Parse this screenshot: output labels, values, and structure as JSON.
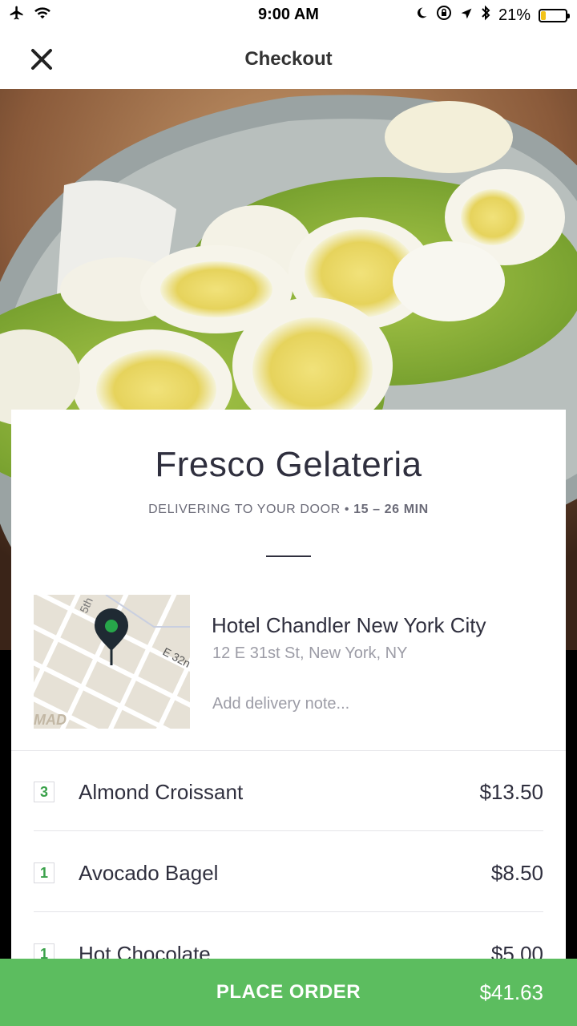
{
  "status_bar": {
    "time": "9:00 AM",
    "battery_percent": "21%",
    "battery_level": 0.21,
    "icons": [
      "airplane-icon",
      "wifi-icon",
      "moon-icon",
      "rotation-lock-icon",
      "location-arrow-icon",
      "bluetooth-icon",
      "battery-icon"
    ]
  },
  "nav": {
    "title": "Checkout",
    "close_icon": "close-icon"
  },
  "restaurant": {
    "name": "Fresco Gelateria",
    "delivery_text": "DELIVERING TO YOUR DOOR",
    "separator": "•",
    "eta": "15 – 26 MIN"
  },
  "address": {
    "name": "Hotel Chandler New York City",
    "line": "12 E 31st St, New York, NY",
    "note_placeholder": "Add delivery note...",
    "map_labels": {
      "street_a": "5th",
      "street_b": "E 32n",
      "area": "MAD"
    }
  },
  "order_items": [
    {
      "qty": "3",
      "name": "Almond Croissant",
      "price": "$13.50"
    },
    {
      "qty": "1",
      "name": "Avocado Bagel",
      "price": "$8.50"
    },
    {
      "qty": "1",
      "name": "Hot Chocolate",
      "price": "$5.00"
    }
  ],
  "place_order": {
    "label": "PLACE ORDER",
    "total": "$41.63"
  },
  "colors": {
    "accent_green": "#5cbd5f",
    "qty_green": "#3aa14a",
    "text_dark": "#2f2f3e",
    "text_muted": "#9c9ca6",
    "battery_yellow": "#f2c218",
    "map_pin": "#1f2a33",
    "map_pin_dot": "#27a64a"
  }
}
